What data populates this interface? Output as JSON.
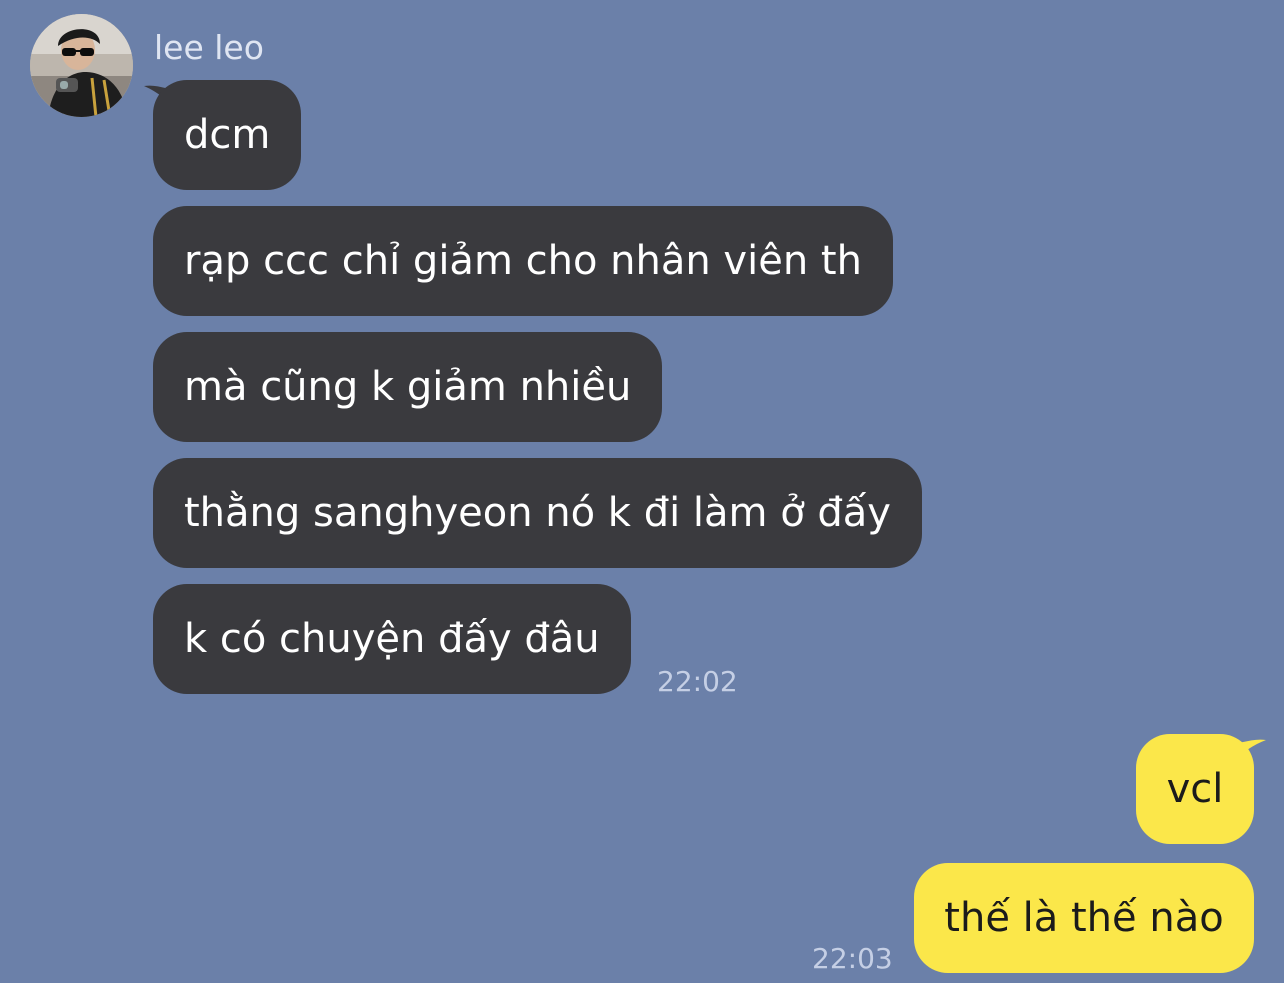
{
  "chat": {
    "sender_name": "lee leo",
    "avatar": "avatar",
    "incoming_messages": [
      "dcm",
      "rạp ccc chỉ giảm cho nhân viên th",
      "mà cũng k giảm nhiều",
      "thằng sanghyeon nó k đi làm ở đấy",
      "k có chuyện đấy đâu"
    ],
    "incoming_time": "22:02",
    "outgoing_messages": [
      "vcl",
      "thế là thế nào"
    ],
    "outgoing_time": "22:03"
  },
  "colors": {
    "background": "#6b80a9",
    "incoming_bubble": "#3a3a3e",
    "outgoing_bubble": "#fbe74a",
    "incoming_text": "#ffffff",
    "outgoing_text": "#1b1b1b"
  }
}
